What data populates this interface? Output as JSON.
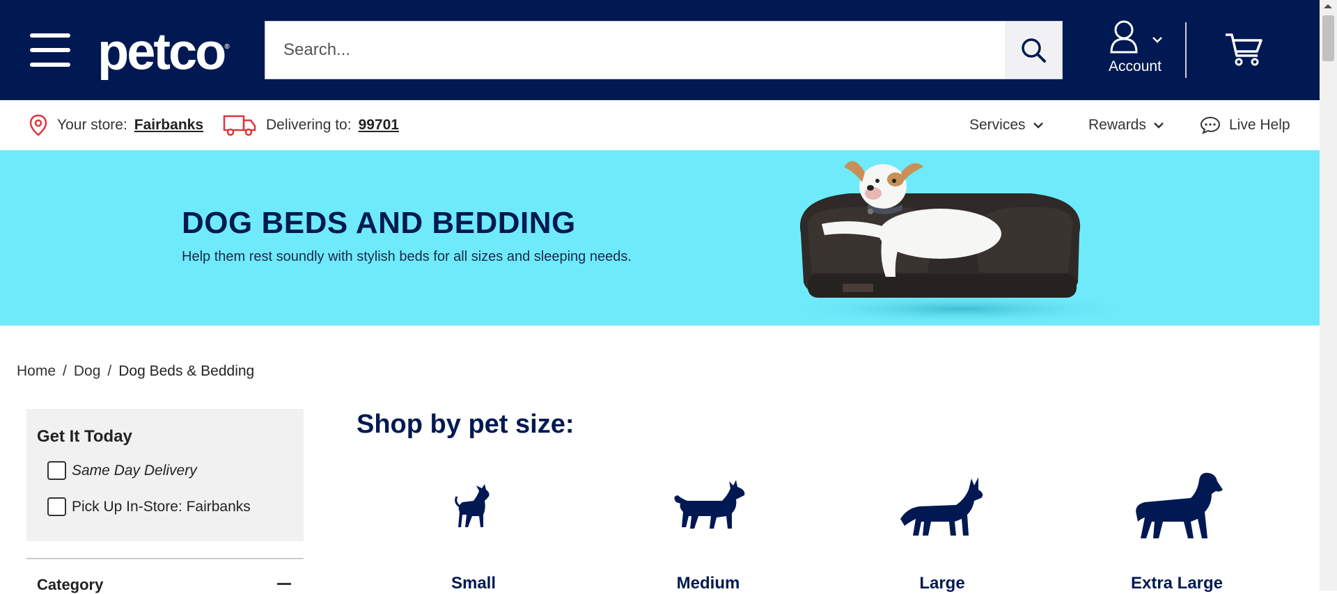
{
  "header": {
    "logo_text": "petco",
    "logo_mark": "®",
    "search_placeholder": "Search...",
    "account_label": "Account"
  },
  "utility": {
    "store_label": "Your store:",
    "store_name": "Fairbanks",
    "delivering_label": "Delivering to:",
    "zip": "99701",
    "services_label": "Services",
    "rewards_label": "Rewards",
    "live_help_label": "Live Help"
  },
  "hero": {
    "title": "DOG BEDS AND BEDDING",
    "subtitle": "Help them rest soundly with stylish beds for all sizes and sleeping needs."
  },
  "breadcrumb": {
    "items": [
      "Home",
      "Dog",
      "Dog Beds & Bedding"
    ],
    "separator": "/"
  },
  "filters": {
    "get_it_today": "Get It Today",
    "same_day": "Same Day Delivery",
    "pickup": "Pick Up In-Store:",
    "pickup_store": "Fairbanks",
    "category": "Category"
  },
  "shop": {
    "title": "Shop by pet size:",
    "sizes": [
      "Small",
      "Medium",
      "Large",
      "Extra Large"
    ]
  },
  "colors": {
    "brand_navy": "#001952",
    "hero_cyan": "#6feafb",
    "store_pin_red": "#e0353a"
  }
}
